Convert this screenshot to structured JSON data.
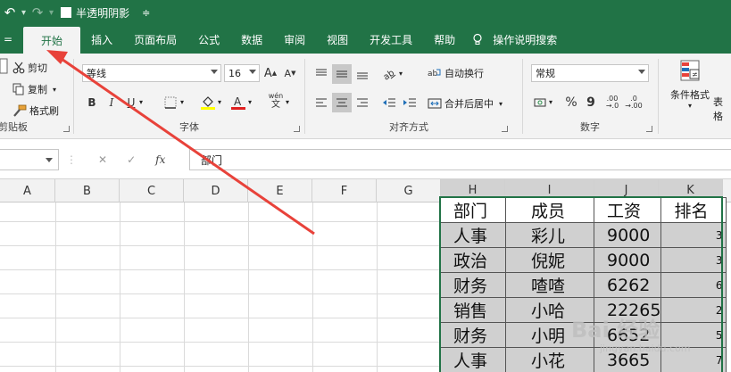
{
  "titlebar": {
    "doc_title": "半透明阴影",
    "undo_glyph": "↶",
    "redo_glyph": "↷",
    "dropdown_glyph": "▾",
    "menu_glyph": "≑"
  },
  "tabs": [
    {
      "label": "开始",
      "active": true
    },
    {
      "label": "插入"
    },
    {
      "label": "页面布局"
    },
    {
      "label": "公式"
    },
    {
      "label": "数据"
    },
    {
      "label": "审阅"
    },
    {
      "label": "视图"
    },
    {
      "label": "开发工具"
    },
    {
      "label": "帮助"
    },
    {
      "label": "操作说明搜索"
    }
  ],
  "ribbon": {
    "clipboard": {
      "label": "剪贴板",
      "cut": "剪切",
      "copy": "复制",
      "format_painter": "格式刷"
    },
    "font": {
      "label": "字体",
      "font_name": "等线",
      "font_size": "16",
      "grow": "A",
      "shrink": "A",
      "bold": "B",
      "italic": "I",
      "underline": "U",
      "wen": "wén",
      "wen2": "文"
    },
    "alignment": {
      "label": "对齐方式",
      "wrap": "自动换行",
      "merge": "合并后居中"
    },
    "number": {
      "label": "数字",
      "format": "常规",
      "percent": "%",
      "comma": "9",
      "inc_dec": ".00",
      "dec_dec": ".0"
    },
    "styles": {
      "cond_format": "条件格式",
      "table_format_partial": "表格"
    }
  },
  "formula_bar": {
    "cancel": "✕",
    "enter": "✓",
    "fx": "fx",
    "content": "部门"
  },
  "columns": [
    "A",
    "B",
    "C",
    "D",
    "E",
    "F",
    "G",
    "H",
    "I",
    "J",
    "K"
  ],
  "table": {
    "headers": [
      "部门",
      "成员",
      "工资",
      "排名"
    ],
    "rows": [
      [
        "人事",
        "彩儿",
        "9000",
        "3"
      ],
      [
        "政治",
        "倪妮",
        "9000",
        "3"
      ],
      [
        "财务",
        "喳喳",
        "6262",
        "6"
      ],
      [
        "销售",
        "小哈",
        "22265",
        "2"
      ],
      [
        "财务",
        "小明",
        "6652",
        "5"
      ],
      [
        "人事",
        "小花",
        "3665",
        "7"
      ]
    ]
  },
  "watermark": {
    "text": "Bai 经验",
    "sub": "jingyan.baidu.com"
  },
  "colors": {
    "accent": "#217346",
    "arrow": "#e8423a",
    "selected_cell": "#d0d0d0"
  }
}
